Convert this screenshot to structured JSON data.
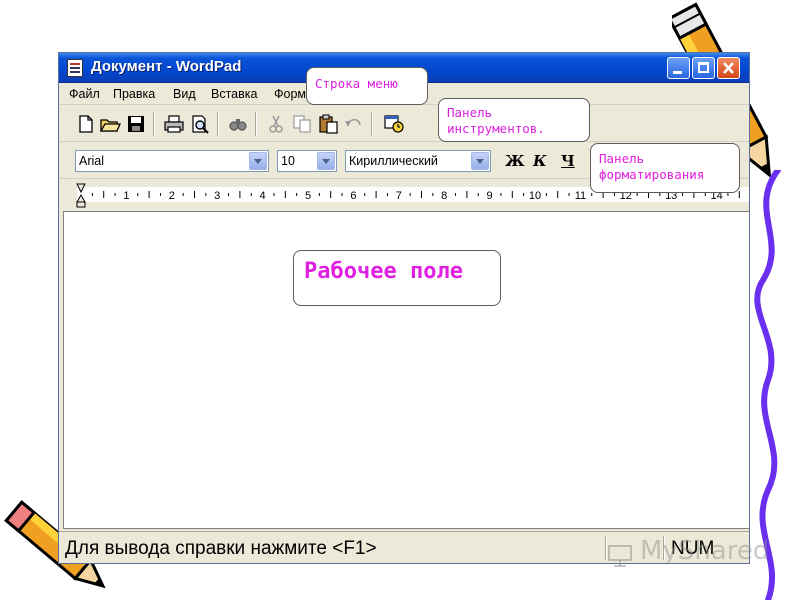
{
  "window": {
    "title": "Документ - WordPad"
  },
  "menubar": {
    "items": [
      "Файл",
      "Правка",
      "Вид",
      "Вставка",
      "Форм"
    ]
  },
  "formatbar": {
    "font": "Arial",
    "size": "10",
    "script": "Кириллический",
    "bold": "Ж",
    "italic": "К",
    "underline": "Ч"
  },
  "ruler": {
    "numbers": [
      "1",
      "2",
      "3",
      "4",
      "5",
      "6",
      "7",
      "8",
      "9",
      "10",
      "11",
      "12",
      "13",
      "14"
    ]
  },
  "statusbar": {
    "help_text": "Для вывода справки нажмите <F1>",
    "num": "NUM"
  },
  "callouts": {
    "menu": "Строка меню",
    "toolbar": "Панель инструментов.",
    "format": "Панель форматирования",
    "work": "Рабочее поле"
  },
  "watermark": "MyShared",
  "colors": {
    "callout_text": "#e020e0",
    "titlebar": "#0247d0",
    "squiggle": "#6a30f0"
  },
  "icons": {
    "toolbar": [
      "new-document-icon",
      "open-folder-icon",
      "save-icon",
      "print-icon",
      "print-preview-icon",
      "find-icon",
      "cut-icon",
      "copy-icon",
      "paste-icon",
      "undo-icon",
      "insert-datetime-icon"
    ]
  }
}
